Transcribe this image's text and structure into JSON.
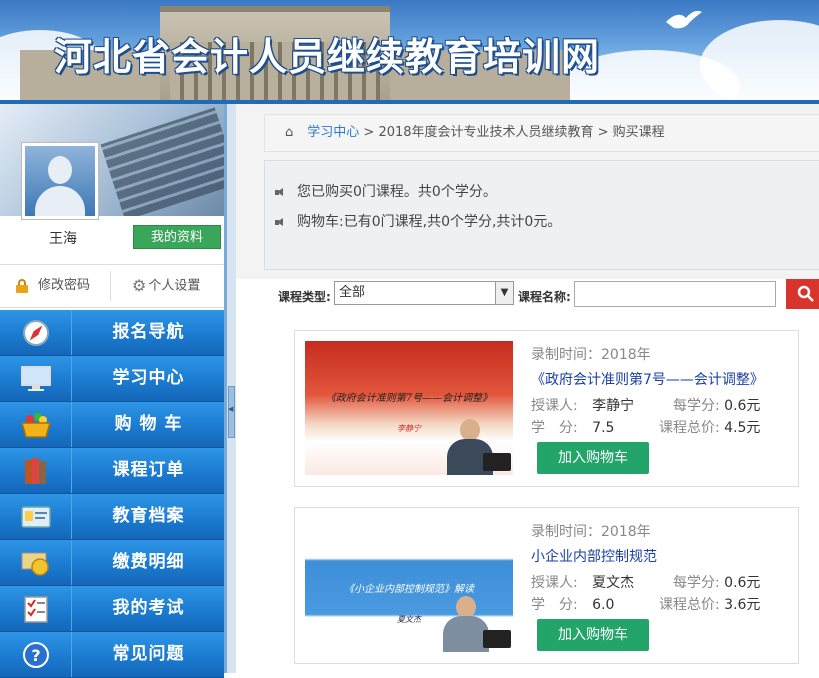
{
  "header": {
    "title": "河北省会计人员继续教育培训网"
  },
  "user": {
    "name": "王海",
    "profile_button": "我的资料",
    "change_password": "修改密码",
    "settings": "个人设置"
  },
  "menu": [
    {
      "icon": "compass-icon",
      "label": "报名导航"
    },
    {
      "icon": "monitor-icon",
      "label": "学习中心"
    },
    {
      "icon": "shopping-basket-icon",
      "label": "购 物 车"
    },
    {
      "icon": "books-icon",
      "label": "课程订单"
    },
    {
      "icon": "id-card-icon",
      "label": "教育档案"
    },
    {
      "icon": "money-icon",
      "label": "缴费明细"
    },
    {
      "icon": "exam-checklist-icon",
      "label": "我的考试"
    },
    {
      "icon": "question-icon",
      "label": "常见问题"
    }
  ],
  "breadcrumb": {
    "link": "学习中心",
    "rest": " > 2018年度会计专业技术人员继续教育 > 购买课程"
  },
  "notice": {
    "purchased": "您已购买0门课程。共0个学分。",
    "cart": "购物车:已有0门课程,共0个学分,共计0元。"
  },
  "filter": {
    "type_label": "课程类型:",
    "type_value": "全部",
    "name_label": "课程名称:",
    "name_value": ""
  },
  "courses": [
    {
      "recorded": "录制时间：2018年",
      "title": "《政府会计准则第7号——会计调整》",
      "thumb_title": "《政府会计准则第7号——会计调整》",
      "thumb_name": "李静宁",
      "teacher_label": "授课人:",
      "teacher": "李静宁",
      "credit_label": "每学分:",
      "credit_price": "0.6元",
      "score_label": "学　分:",
      "score": "7.5",
      "total_label": "课程总价:",
      "total": "4.5元",
      "add_label": "加入购物车"
    },
    {
      "recorded": "录制时间：2018年",
      "title": "小企业内部控制规范",
      "thumb_title": "《小企业内部控制规范》解读",
      "thumb_name": "夏文杰",
      "teacher_label": "授课人:",
      "teacher": "夏文杰",
      "credit_label": "每学分:",
      "credit_price": "0.6元",
      "score_label": "学　分:",
      "score": "6.0",
      "total_label": "课程总价:",
      "total": "3.6元",
      "add_label": "加入购物车"
    }
  ]
}
